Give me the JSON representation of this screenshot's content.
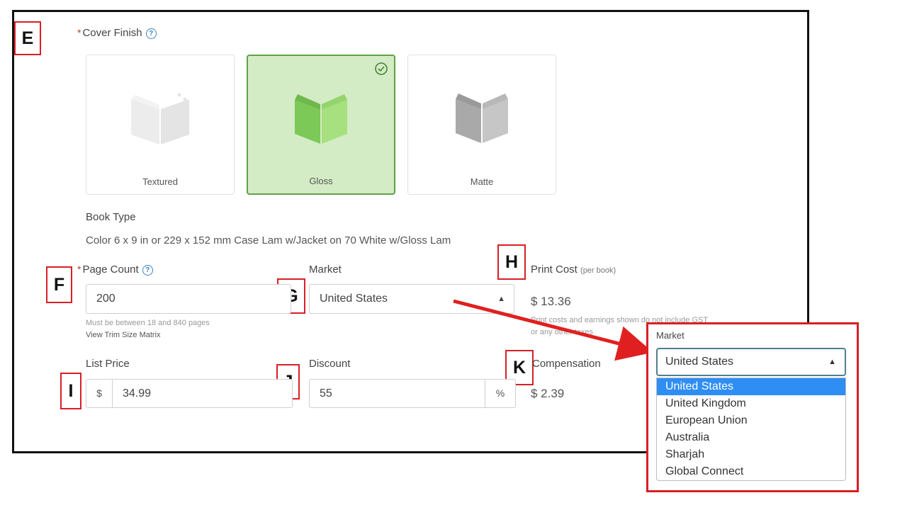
{
  "markers": {
    "e": "E",
    "f": "F",
    "g": "G",
    "h": "H",
    "i": "I",
    "j": "J",
    "k": "K"
  },
  "cover_finish": {
    "label": "Cover Finish",
    "options": [
      {
        "name": "Textured",
        "color": "#e8e8e8"
      },
      {
        "name": "Gloss",
        "color": "#8fd36a",
        "selected": true
      },
      {
        "name": "Matte",
        "color": "#b5b5b5"
      }
    ]
  },
  "book_type": {
    "label": "Book Type",
    "value": "Color 6 x 9 in or 229 x 152 mm Case Lam w/Jacket on 70 White w/Gloss Lam"
  },
  "page_count": {
    "label": "Page Count",
    "value": "200",
    "hint": "Must be between 18 and 840 pages",
    "link": "View Trim Size Matrix"
  },
  "market": {
    "label": "Market",
    "value": "United States"
  },
  "print_cost": {
    "label": "Print Cost",
    "sub": "(per book)",
    "value": "$ 13.36",
    "note_line1": "Print costs and earnings shown do not include GST",
    "note_line2": "or any other taxes"
  },
  "list_price": {
    "label": "List Price",
    "currency": "$",
    "value": "34.99"
  },
  "discount": {
    "label": "Discount",
    "value": "55",
    "unit": "%"
  },
  "compensation": {
    "label": "Compensation",
    "value": "$ 2.39"
  },
  "market_popup": {
    "label": "Market",
    "selected": "United States",
    "options": [
      "United States",
      "United Kingdom",
      "European Union",
      "Australia",
      "Sharjah",
      "Global Connect"
    ]
  },
  "colors": {
    "annotation_red": "#d81f26",
    "selected_option": "#2f8ef4",
    "gloss_selected_bg": "#d4ecc5"
  }
}
